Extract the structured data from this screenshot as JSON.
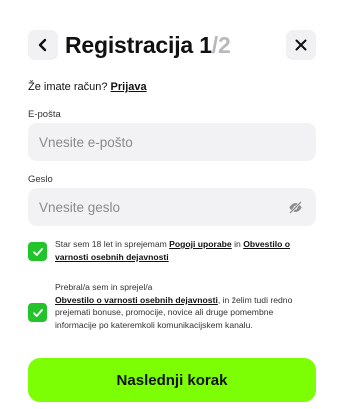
{
  "header": {
    "title": "Registracija",
    "step_current": "1",
    "step_separator": "/",
    "step_total": "2",
    "back_icon": "chevron-left-icon",
    "close_icon": "close-icon"
  },
  "login": {
    "prompt": "Že imate račun?",
    "link_label": "Prijava"
  },
  "email": {
    "label": "E-pošta",
    "placeholder": "Vnesite e-pošto",
    "value": ""
  },
  "password": {
    "label": "Geslo",
    "placeholder": "Vnesite geslo",
    "value": "",
    "toggle_icon": "eye-off-icon"
  },
  "consents": [
    {
      "checked": true,
      "text_before": "Star sem 18 let in sprejemam",
      "link1": "Pogoji uporabe",
      "text_middle": "in",
      "link2": "Obvestilo o varnosti osebnih dejavnosti",
      "text_after": ""
    },
    {
      "checked": true,
      "text_before": "Prebral/a sem in sprejel/a",
      "link1": "Obvestilo o varnosti osebnih dejavnosti",
      "text_after": ", in želim tudi redno prejemati bonuse, promocije, novice ali druge pomembne informacije po kateremkoli komunikacijskem kanalu."
    }
  ],
  "cta": {
    "label": "Naslednji korak"
  },
  "colors": {
    "accent": "#7cff04",
    "checkbox": "#22c32b",
    "field_bg": "#f2f2f4",
    "muted": "#b9b9bd"
  }
}
